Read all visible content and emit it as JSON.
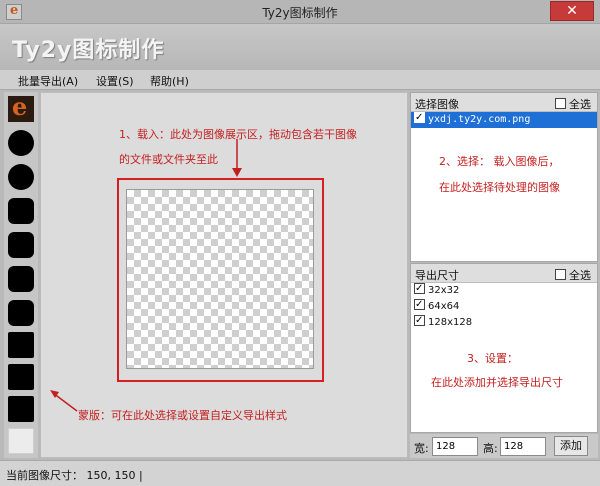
{
  "window": {
    "title": "Ty2y图标制作",
    "close_glyph": "✕"
  },
  "banner": {
    "brand": "Ty2y图标制作"
  },
  "menu": {
    "items": [
      "批量导出(A)",
      "设置(S)",
      "帮助(H)"
    ]
  },
  "sidebar": {
    "thumbnails": [
      "e-logo-icon",
      "circle-mask",
      "circle-mask",
      "rounded-square-mask",
      "rounded-square-mask",
      "rounded-square-mask",
      "rounded-square-mask",
      "square-mask",
      "square-mask",
      "square-mask",
      "blank-mask"
    ]
  },
  "canvas": {
    "note1_line1": "1、载入：此处为图像展示区，拖动包含若干图像",
    "note1_line2": "的文件或文件夹至此",
    "mask_note": "蒙版：可在此处选择或设置自定义导出样式"
  },
  "images_panel": {
    "title": "选择图像",
    "select_all": "全选",
    "items": [
      {
        "name": "yxdj.ty2y.com.png",
        "checked": true,
        "selected": true
      }
    ],
    "note_line1": "2、选择：   载入图像后，",
    "note_line2": "在此处选择待处理的图像"
  },
  "sizes_panel": {
    "title": "导出尺寸",
    "select_all": "全选",
    "items": [
      {
        "label": "32x32",
        "checked": true
      },
      {
        "label": "64x64",
        "checked": true
      },
      {
        "label": "128x128",
        "checked": true
      }
    ],
    "note_line1": "3、设置：",
    "note_line2": "在此处添加并选择导出尺寸"
  },
  "size_controls": {
    "width_label": "宽:",
    "width_value": "128",
    "height_label": "高:",
    "height_value": "128",
    "add_button": "添加"
  },
  "status": {
    "text": "当前图像尺寸： 150, 150  |"
  },
  "colors": {
    "annotation": "#c41f1f",
    "selection": "#1e6fd6"
  }
}
